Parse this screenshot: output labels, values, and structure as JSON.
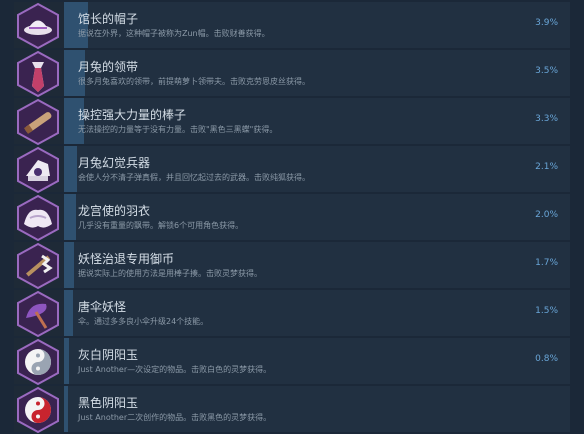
{
  "achievements": [
    {
      "title": "馆长的帽子",
      "desc": "据说在外界，这种帽子被称为Zun帽。击败财善获得。",
      "percent": "3.9%",
      "icon": "hat-icon",
      "fill": 0.039
    },
    {
      "title": "月兔的领带",
      "desc": "很多月兔喜欢的领带，前提萌萝卜领带夫。击败克劳恩皮丝获得。",
      "percent": "3.5%",
      "icon": "necktie-icon",
      "fill": 0.035
    },
    {
      "title": "操控强大力量的棒子",
      "desc": "无法操控的力量等于没有力量。击败\"黑色三黑蝶\"获得。",
      "percent": "3.3%",
      "icon": "stick-icon",
      "fill": 0.033
    },
    {
      "title": "月兔幻觉兵器",
      "desc": "会使人分不清子弹真假，并且回忆起过去的武器。击败纯狐获得。",
      "percent": "2.1%",
      "icon": "weapon-icon",
      "fill": 0.021
    },
    {
      "title": "龙宫使的羽衣",
      "desc": "几乎没有重量的飘带。解锁6个可用角色获得。",
      "percent": "2.0%",
      "icon": "robe-icon",
      "fill": 0.02
    },
    {
      "title": "妖怪治退专用御币",
      "desc": "据说实际上的使用方法是用棒子揍。击败灵梦获得。",
      "percent": "1.7%",
      "icon": "gohei-icon",
      "fill": 0.017
    },
    {
      "title": "唐伞妖怪",
      "desc": "伞。通过多多良小伞升级24个技能。",
      "percent": "1.5%",
      "icon": "umbrella-icon",
      "fill": 0.015
    },
    {
      "title": "灰白阴阳玉",
      "desc": "Just Another—次设定的物品。击败白色的灵梦获得。",
      "percent": "0.8%",
      "icon": "yinyang-gray-icon",
      "fill": 0.008
    },
    {
      "title": "黑色阴阳玉",
      "desc": "Just Another二次创作的物品。击败黑色的灵梦获得。",
      "percent": "",
      "icon": "yinyang-red-icon",
      "fill": 0.006
    }
  ]
}
